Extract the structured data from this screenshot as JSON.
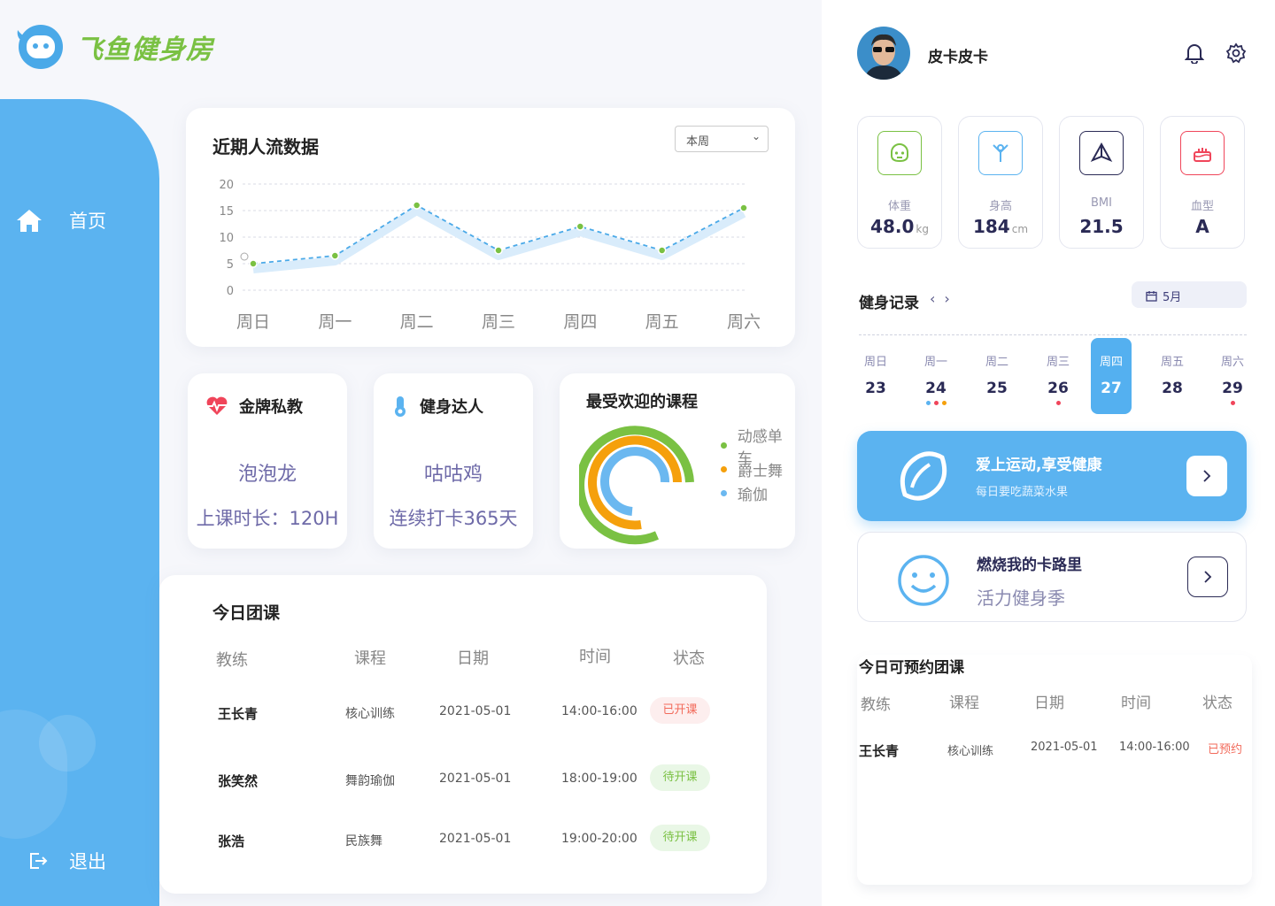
{
  "brand": {
    "name": "飞鱼健身房"
  },
  "nav": {
    "home": "首页",
    "logout": "退出"
  },
  "traffic": {
    "title": "近期人流数据",
    "range_select": "本周"
  },
  "chart_data": {
    "type": "line",
    "title": "近期人流数据",
    "categories": [
      "周日",
      "周一",
      "周二",
      "周三",
      "周四",
      "周五",
      "周六"
    ],
    "series": [
      {
        "values": [
          5,
          6.5,
          16,
          7.5,
          12,
          7.5,
          15.5
        ]
      }
    ],
    "yticks": [
      0,
      5,
      10,
      15,
      20
    ],
    "ylim": [
      0,
      20
    ],
    "grid": true,
    "colors": {
      "line": "#4aa9e8",
      "point": "#7ac143"
    }
  },
  "cards": {
    "coach": {
      "title": "金牌私教",
      "name": "泡泡龙",
      "detail": "上课时长：120H"
    },
    "member": {
      "title": "健身达人",
      "name": "咕咕鸡",
      "detail": "连续打卡365天"
    },
    "favorite": {
      "title": "最受欢迎的课程",
      "legend": [
        {
          "label": "动感单车",
          "color": "#7ac143"
        },
        {
          "label": "爵士舞",
          "color": "#f5a00c"
        },
        {
          "label": "瑜伽",
          "color": "#6bb8f0"
        }
      ]
    }
  },
  "classes": {
    "title": "今日团课",
    "headers": [
      "教练",
      "课程",
      "日期",
      "时间",
      "状态"
    ],
    "rows": [
      {
        "coach": "王长青",
        "course": "核心训练",
        "date": "2021-05-01",
        "time": "14:00-16:00",
        "status": "已开课",
        "status_type": "on"
      },
      {
        "coach": "张笑然",
        "course": "舞韵瑜伽",
        "date": "2021-05-01",
        "time": "18:00-19:00",
        "status": "待开课",
        "status_type": "wait"
      },
      {
        "coach": "张浩",
        "course": "民族舞",
        "date": "2021-05-01",
        "time": "19:00-20:00",
        "status": "待开课",
        "status_type": "wait"
      }
    ]
  },
  "user": {
    "name": "皮卡皮卡"
  },
  "stats": [
    {
      "label": "体重",
      "value": "48.0",
      "unit": "kg",
      "icon": "face-icon",
      "color": "#7ac143"
    },
    {
      "label": "身高",
      "value": "184",
      "unit": "cm",
      "icon": "person-icon",
      "color": "#5bb3f0"
    },
    {
      "label": "BMI",
      "value": "21.5",
      "unit": "",
      "icon": "bmi-icon",
      "color": "#2a2a55"
    },
    {
      "label": "血型",
      "value": "A",
      "unit": "",
      "icon": "cake-icon",
      "color": "#f0455a"
    }
  ],
  "records": {
    "title": "健身记录",
    "month": "5月",
    "days": [
      {
        "w": "周日",
        "d": "23",
        "dots": []
      },
      {
        "w": "周一",
        "d": "24",
        "dots": [
          "#5bb3f0",
          "#f0455a",
          "#f5a00c"
        ]
      },
      {
        "w": "周二",
        "d": "25",
        "dots": []
      },
      {
        "w": "周三",
        "d": "26",
        "dots": [
          "#f0455a"
        ]
      },
      {
        "w": "周四",
        "d": "27",
        "dots": [],
        "selected": true
      },
      {
        "w": "周五",
        "d": "28",
        "dots": []
      },
      {
        "w": "周六",
        "d": "29",
        "dots": [
          "#f0455a"
        ]
      }
    ]
  },
  "promos": [
    {
      "title": "爱上运动,享受健康",
      "subtitle": "每日要吃蔬菜水果"
    },
    {
      "title": "燃烧我的卡路里",
      "subtitle": "活力健身季"
    }
  ],
  "booking": {
    "title": "今日可预约团课",
    "headers": [
      "教练",
      "课程",
      "日期",
      "时间",
      "状态"
    ],
    "rows": [
      {
        "coach": "王长青",
        "course": "核心训练",
        "date": "2021-05-01",
        "time": "14:00-16:00",
        "status": "已预约"
      }
    ]
  }
}
